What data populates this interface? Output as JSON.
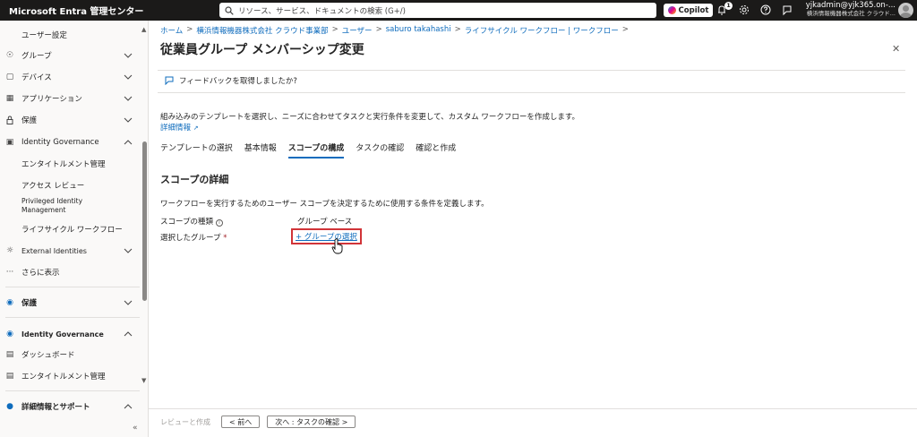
{
  "topbar": {
    "brand": "Microsoft Entra 管理センター",
    "search_placeholder": "リソース、サービス、ドキュメントの検索 (G+/)",
    "copilot_label": "Copilot",
    "notification_count": "1",
    "user_email": "yjkadmin@yjk365.on-...",
    "user_org": "横浜情報機器株式会社 クラウド..."
  },
  "sidebar": {
    "items": [
      {
        "label": "ユーザー設定",
        "type": "sub",
        "icon": ""
      },
      {
        "label": "グループ",
        "icon": "group-icon"
      },
      {
        "label": "デバイス",
        "icon": "device-icon"
      },
      {
        "label": "アプリケーション",
        "icon": "app-icon"
      },
      {
        "label": "保護",
        "icon": "lock-icon"
      },
      {
        "label": "Identity Governance",
        "icon": "governance-icon"
      },
      {
        "label": "エンタイトルメント管理",
        "type": "sub"
      },
      {
        "label": "アクセス レビュー",
        "type": "sub"
      },
      {
        "label": "Privileged Identity Management",
        "type": "sub"
      },
      {
        "label": "ライフサイクル ワークフロー",
        "type": "sub"
      },
      {
        "label": "External Identities",
        "icon": "external-icon"
      },
      {
        "label": "さらに表示",
        "icon": "more-icon"
      }
    ],
    "section2": [
      {
        "label": "保護",
        "icon": "protect-icon"
      },
      {
        "label": "Identity Governance",
        "icon": "governance-icon"
      },
      {
        "label": "ダッシュボード",
        "icon": "dashboard-icon"
      },
      {
        "label": "エンタイトルメント管理",
        "icon": "entitlement-icon"
      },
      {
        "label": "詳細情報とサポート",
        "icon": "support-icon"
      }
    ]
  },
  "breadcrumb": [
    "ホーム",
    "横浜情報機器株式会社 クラウド事業部",
    "ユーザー",
    "saburo takahashi",
    "ライフサイクル ワークフロー | ワークフロー"
  ],
  "page": {
    "title": "従業員グループ メンバーシップ変更",
    "feedback": "フィードバックを取得しましたか?",
    "description": "組み込みのテンプレートを選択し、ニーズに合わせてタスクと実行条件を変更して、カスタム ワークフローを作成します。",
    "learn_more": "詳細情報",
    "tabs": [
      "テンプレートの選択",
      "基本情報",
      "スコープの構成",
      "タスクの確認",
      "確認と作成"
    ],
    "active_tab": 2,
    "section_title": "スコープの詳細",
    "scope_description": "ワークフローを実行するためのユーザー スコープを決定するために使用する条件を定義します。",
    "scope_type_label": "スコープの種類",
    "scope_type_value": "グループ ベース",
    "selected_group_label": "選択したグループ",
    "select_group_link": "+ グループの選択"
  },
  "footer": {
    "review_create": "レビューと作成",
    "prev": "< 前へ",
    "next": "次へ : タスクの確認 >"
  }
}
